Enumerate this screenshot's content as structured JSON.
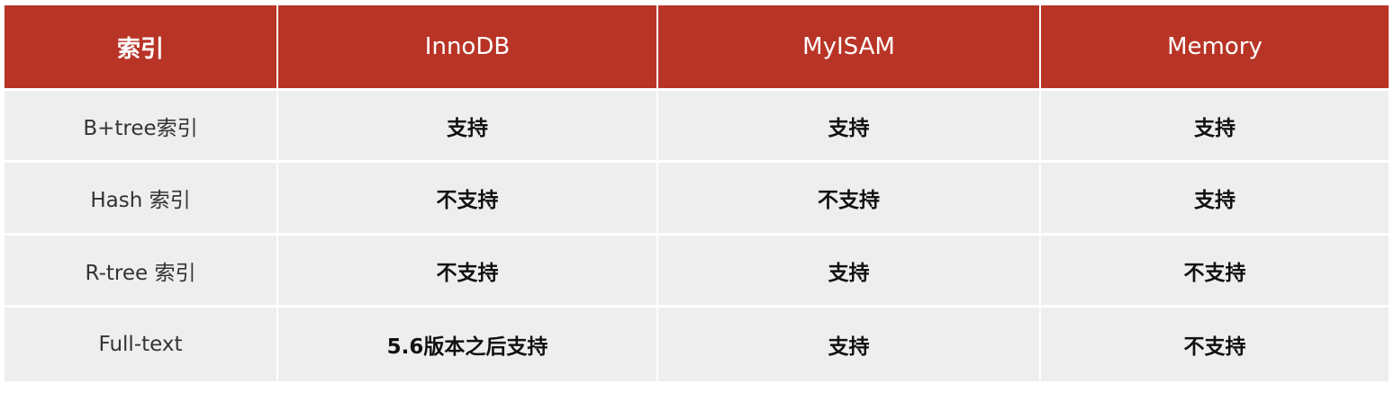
{
  "colors": {
    "accent": "#b83426",
    "row_bg": "#eeeeee",
    "header_text": "#ffffff"
  },
  "table": {
    "headers": [
      "索引",
      "InnoDB",
      "MyISAM",
      "Memory"
    ],
    "rows": [
      {
        "label": "B+tree索引",
        "values": [
          "支持",
          "支持",
          "支持"
        ]
      },
      {
        "label": "Hash 索引",
        "values": [
          "不支持",
          "不支持",
          "支持"
        ]
      },
      {
        "label": "R-tree 索引",
        "values": [
          "不支持",
          "支持",
          "不支持"
        ]
      },
      {
        "label": "Full-text",
        "values": [
          "5.6版本之后支持",
          "支持",
          "不支持"
        ]
      }
    ]
  }
}
